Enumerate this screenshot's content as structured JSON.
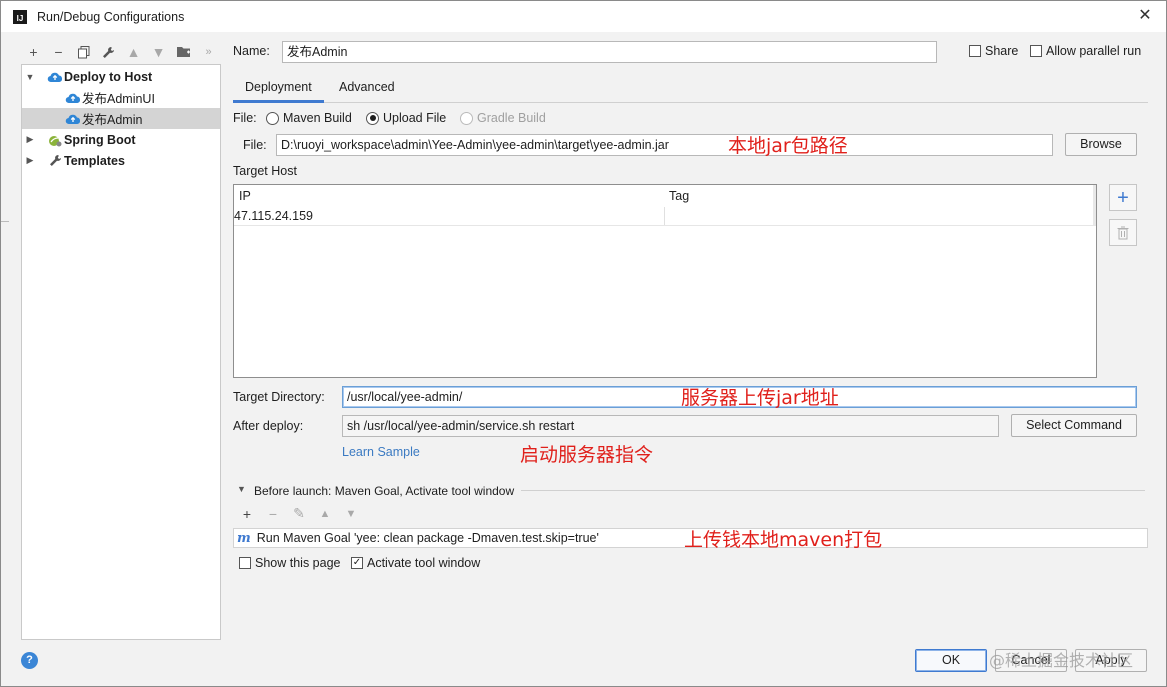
{
  "window": {
    "title": "Run/Debug Configurations",
    "app_icon": "IJ"
  },
  "left_toolbar": {
    "icons": [
      "add-icon",
      "remove-icon",
      "copy-icon",
      "wrench-icon",
      "move-up-icon",
      "move-down-icon",
      "folder-icon",
      "more-icon"
    ]
  },
  "tree": {
    "items": [
      {
        "label": "Deploy to Host",
        "icon": "cloud-upload-icon",
        "expanded": true,
        "bold": true,
        "level": 0
      },
      {
        "label": "发布AdminUI",
        "icon": "cloud-upload-icon",
        "level": 1
      },
      {
        "label": "发布Admin",
        "icon": "cloud-upload-icon",
        "level": 1,
        "selected": true
      },
      {
        "label": "Spring Boot",
        "icon": "spring-leaf-icon",
        "expanded": false,
        "bold": true,
        "level": 0
      },
      {
        "label": "Templates",
        "icon": "wrench-icon",
        "expanded": false,
        "bold": true,
        "level": 0
      }
    ]
  },
  "name_field": {
    "label": "Name:",
    "value": "发布Admin"
  },
  "share": {
    "label": "Share",
    "checked": false
  },
  "parallel": {
    "label": "Allow parallel run",
    "checked": false
  },
  "tabs": [
    {
      "label": "Deployment",
      "active": true
    },
    {
      "label": "Advanced",
      "active": false
    }
  ],
  "file_mode": {
    "label": "File:",
    "options": [
      {
        "label": "Maven Build",
        "selected": false,
        "enabled": true
      },
      {
        "label": "Upload File",
        "selected": true,
        "enabled": true
      },
      {
        "label": "Gradle Build",
        "selected": false,
        "enabled": false
      }
    ]
  },
  "file_path": {
    "label": "File:",
    "value": "D:\\ruoyi_workspace\\admin\\Yee-Admin\\yee-admin\\target\\yee-admin.jar",
    "browse_label": "Browse"
  },
  "target_host": {
    "label": "Target Host",
    "columns": [
      "IP",
      "Tag"
    ],
    "rows": [
      {
        "ip": "47.115.24.159",
        "tag": ""
      }
    ]
  },
  "target_directory": {
    "label": "Target Directory:",
    "value": "/usr/local/yee-admin/"
  },
  "after_deploy": {
    "label": "After deploy:",
    "value": "sh /usr/local/yee-admin/service.sh restart",
    "button_label": "Select Command"
  },
  "learn_sample": "Learn Sample",
  "before_launch": {
    "label": "Before launch: Maven Goal, Activate tool window",
    "task": "Run Maven Goal 'yee: clean package -Dmaven.test.skip=true'",
    "show_page": {
      "label": "Show this page",
      "checked": false
    },
    "activate_window": {
      "label": "Activate tool window",
      "checked": true
    }
  },
  "annotations": {
    "jar_path": "本地jar包路径",
    "upload_dir": "服务器上传jar地址",
    "start_cmd": "启动服务器指令",
    "maven_pack": "上传钱本地maven打包"
  },
  "footer": {
    "ok": "OK",
    "cancel": "Cancel",
    "apply": "Apply",
    "watermark": "@稀土掘金技术社区"
  },
  "colors": {
    "accent": "#3f7ad0",
    "annotation": "#e0201b",
    "link": "#3b7ac2"
  }
}
